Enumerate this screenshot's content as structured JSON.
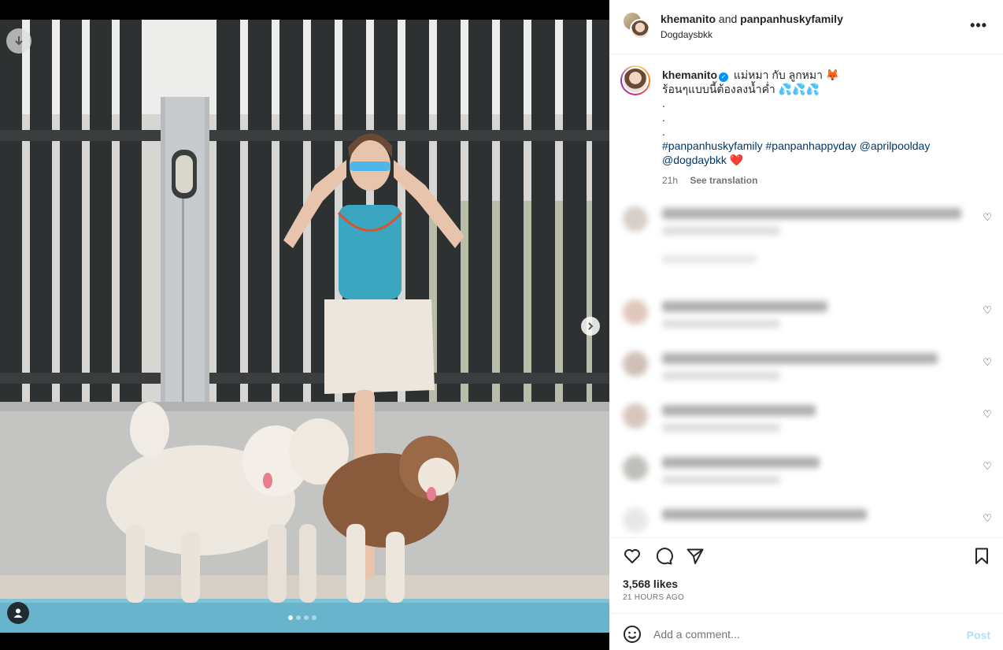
{
  "header": {
    "user1": "khemanito",
    "and_text": "and",
    "user2": "panpanhuskyfamily",
    "location": "Dogdaysbkk"
  },
  "caption": {
    "username": "khemanito",
    "line1": "แม่หมา กับ ลูกหมา 🦊",
    "line2": "ร้อนๆแบบนี้ต้องลงน้ำค่ำ 💦💦💦",
    "dot1": ".",
    "dot2": ".",
    "dot3": ".",
    "tags_line1": "#panpanhuskyfamily #panpanhappyday @aprilpoolday",
    "tags_line2": "@dogdaybkk",
    "heart": "❤️",
    "time": "21h",
    "see_translation": "See translation"
  },
  "stats": {
    "likes": "3,568 likes",
    "ago": "21 HOURS AGO"
  },
  "comment_box": {
    "placeholder": "Add a comment...",
    "post_label": "Post"
  },
  "icons": {
    "more": "more-options-icon",
    "like": "heart-icon",
    "comment": "comment-icon",
    "share": "share-icon",
    "save": "bookmark-icon",
    "emoji": "emoji-icon"
  },
  "colors": {
    "accent": "#0095f6",
    "link": "#00376b",
    "post_disabled": "#b2dffc"
  }
}
